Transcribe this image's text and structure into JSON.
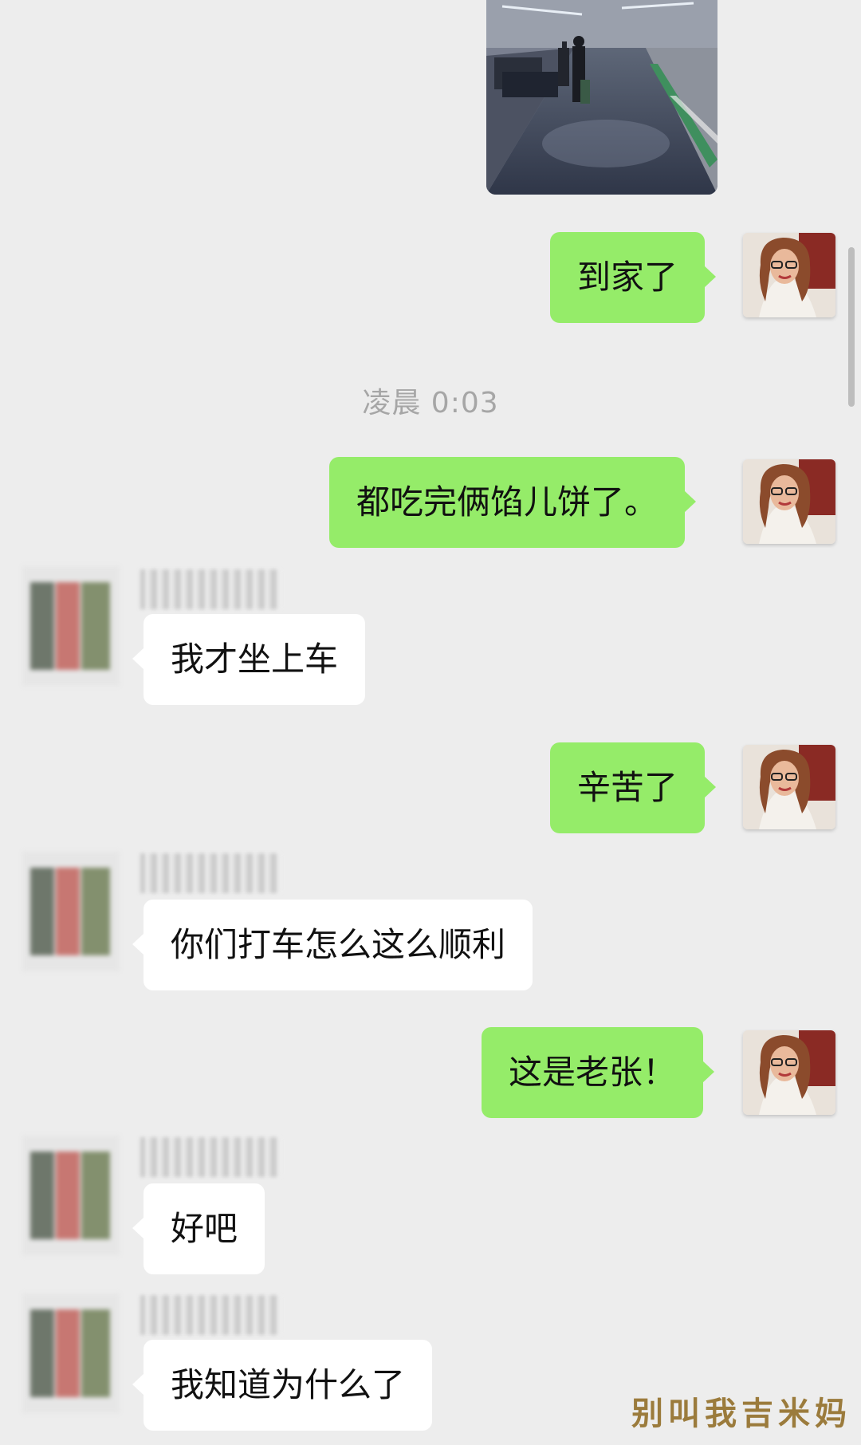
{
  "timestamp": "凌晨 0:03",
  "messages": [
    {
      "type": "sent",
      "text": "到家了"
    },
    {
      "type": "sent",
      "text": "都吃完俩馅儿饼了。"
    },
    {
      "type": "received",
      "text": "我才坐上车"
    },
    {
      "type": "sent",
      "text": "辛苦了"
    },
    {
      "type": "received",
      "text": "你们打车怎么这么顺利"
    },
    {
      "type": "sent",
      "text": "这是老张！"
    },
    {
      "type": "received",
      "text": "好吧"
    },
    {
      "type": "received",
      "text": "我知道为什么了"
    }
  ],
  "watermark": "别叫我吉米妈",
  "colors": {
    "background": "#ededed",
    "sent_bubble": "#95ec69",
    "received_bubble": "#ffffff",
    "timestamp_text": "#a6a6a6",
    "watermark_text": "#9b7b3c"
  }
}
